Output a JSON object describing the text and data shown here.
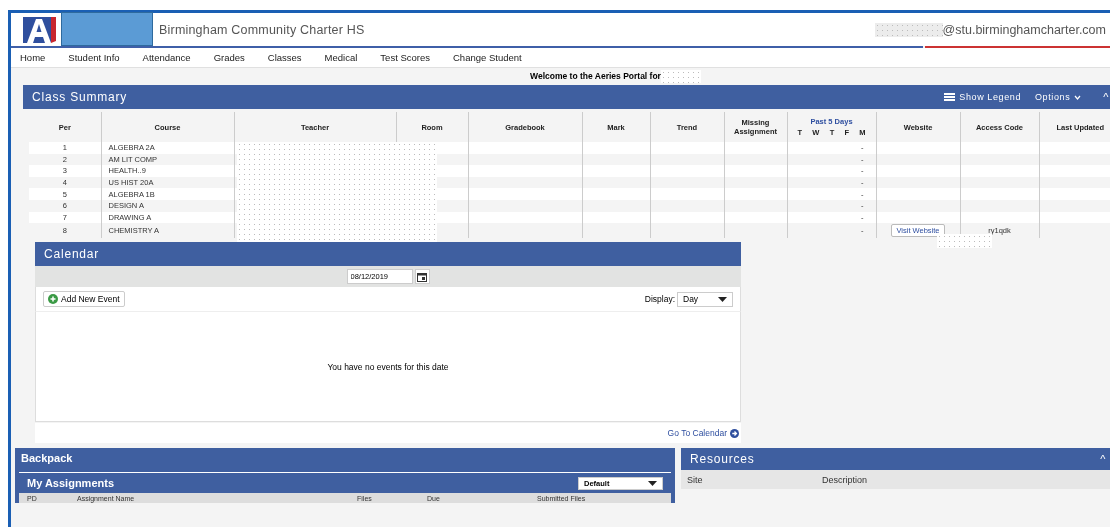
{
  "header": {
    "school": "Birmingham Community Charter HS",
    "email": "@stu.birminghamcharter.com"
  },
  "nav": [
    {
      "label": "Home"
    },
    {
      "label": "Student Info"
    },
    {
      "label": "Attendance"
    },
    {
      "label": "Grades"
    },
    {
      "label": "Classes"
    },
    {
      "label": "Medical"
    },
    {
      "label": "Test Scores"
    },
    {
      "label": "Change Student"
    }
  ],
  "welcome": "Welcome to the Aeries Portal for",
  "class_summary": {
    "title": "Class Summary",
    "legend_button": "Show Legend",
    "options_button": "Options",
    "collapse": "^",
    "columns": [
      "Per",
      "Course",
      "Teacher",
      "Room",
      "Gradebook",
      "Mark",
      "Trend",
      "Missing Assignment",
      "Past 5 Days",
      "Website",
      "Access Code",
      "Last Updated"
    ],
    "past_days": [
      "T",
      "W",
      "T",
      "F",
      "M"
    ],
    "rows": [
      {
        "per": "1",
        "course": "ALGEBRA 2A",
        "m": "-"
      },
      {
        "per": "2",
        "course": "AM LIT COMP",
        "m": "-"
      },
      {
        "per": "3",
        "course": "HEALTH..9",
        "m": "-"
      },
      {
        "per": "4",
        "course": "US HIST 20A",
        "m": "-"
      },
      {
        "per": "5",
        "course": "ALGEBRA 1B",
        "m": "-"
      },
      {
        "per": "6",
        "course": "DESIGN A",
        "m": "-"
      },
      {
        "per": "7",
        "course": "DRAWING A",
        "m": "-"
      },
      {
        "per": "8",
        "course": "CHEMISTRY A",
        "m": "-",
        "website_button": "Visit Website",
        "access_code": "ry1qdk"
      }
    ]
  },
  "calendar": {
    "title": "Calendar",
    "date": "08/12/2019",
    "add_button": "Add New Event",
    "display_label": "Display:",
    "display_value": "Day",
    "empty_message": "You have no events for this date",
    "go_link": "Go To Calendar"
  },
  "backpack": {
    "title": "Backpack",
    "assignments_title": "My Assignments",
    "filter": "Default",
    "columns": [
      "PD",
      "Assignment Name",
      "Files",
      "Due",
      "Submitted Files"
    ]
  },
  "resources": {
    "title": "Resources",
    "collapse": "^",
    "columns": [
      "Site",
      "Description"
    ]
  }
}
